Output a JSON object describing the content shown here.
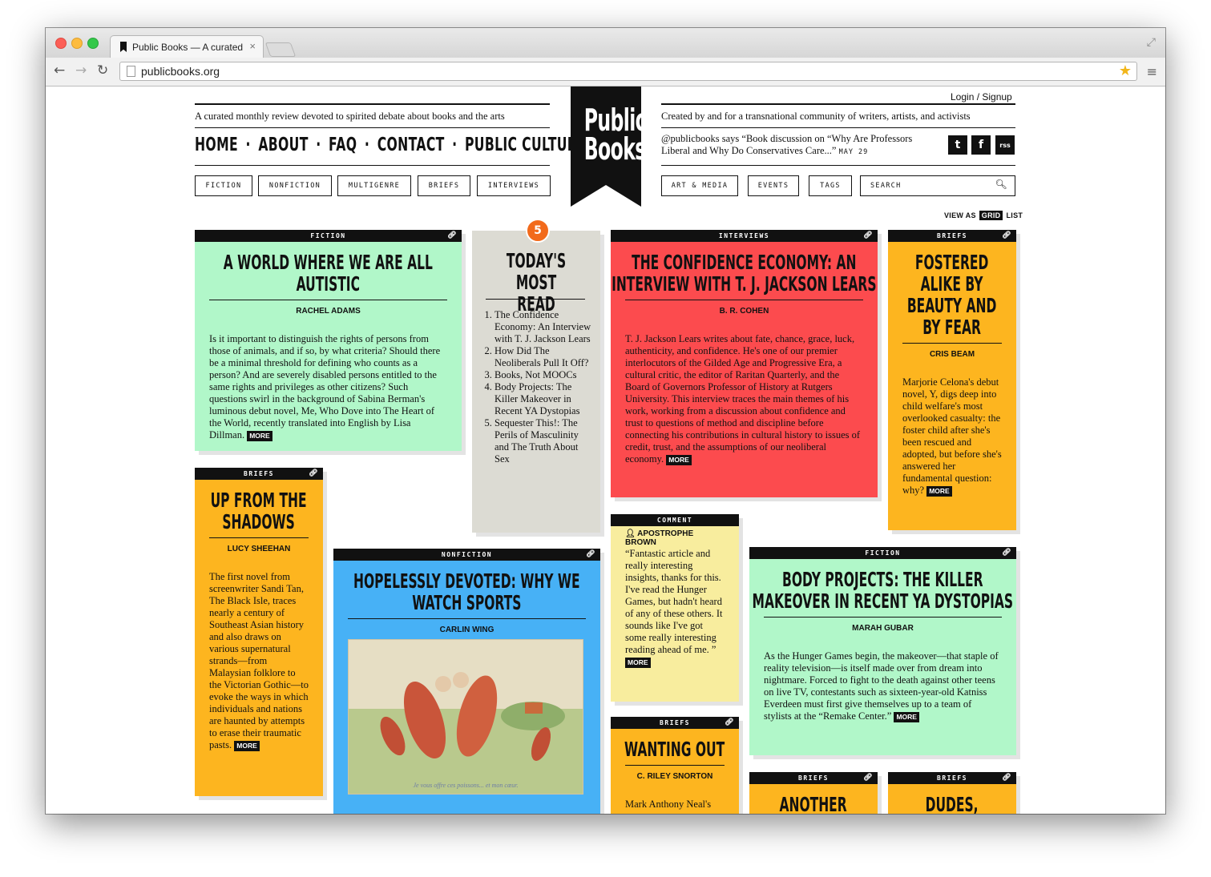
{
  "browser": {
    "tab_title": "Public Books — A curated",
    "tab_close": "×",
    "url": "publicbooks.org",
    "back": "←",
    "forward": "→",
    "reload": "↻",
    "star": "★",
    "menu": "≡",
    "expand": "⤢"
  },
  "header": {
    "login": "Login / Signup",
    "tagline_left": "A curated monthly review devoted to spirited debate about books and the arts",
    "tagline_right": "Created by and for a transnational community of writers, artists, and activists",
    "logo_line1": "Public",
    "logo_line2": "Books",
    "nav": [
      "HOME",
      "ABOUT",
      "FAQ",
      "CONTACT",
      "PUBLIC CULTURE"
    ],
    "nav_sep": "·",
    "categories_left": [
      "FICTION",
      "NONFICTION",
      "MULTIGENRE",
      "BRIEFS",
      "INTERVIEWS"
    ],
    "categories_right": [
      "ART & MEDIA",
      "EVENTS",
      "TAGS"
    ],
    "search_placeholder": "SEARCH",
    "tweet_text": "@publicbooks says “Book discussion on “Why Are Professors Liberal and Why Do Conservatives Care...”",
    "tweet_date": "MAY 29",
    "social": [
      "t",
      "f",
      "rss"
    ],
    "view_as": "VIEW AS",
    "view_grid": "GRID",
    "view_list": "LIST"
  },
  "cards": {
    "autistic": {
      "category": "FICTION",
      "title": "A WORLD WHERE WE ARE ALL AUTISTIC",
      "author": "RACHEL ADAMS",
      "text": "Is it important to distinguish the rights of persons from those of animals, and if so, by what criteria? Should there be a minimal threshold for defining who counts as a person? And are severely disabled persons entitled to the same rights and privileges as other citizens? Such questions swirl in the background of Sabina Berman's luminous debut novel, Me, Who Dove into The Heart of the World, recently translated into English by Lisa Dillman.",
      "more": "MORE",
      "color": "#b1f7c9"
    },
    "most_read": {
      "badge": "5",
      "title": "TODAY'S MOST READ",
      "items": [
        "The Confidence Economy: An Interview with T. J. Jackson Lears",
        "How Did The Neoliberals Pull It Off?",
        "Books, Not MOOCs",
        "Body Projects: The Killer Makeover in Recent YA Dystopias",
        "Sequester This!: The Perils of Masculinity and The Truth About Sex"
      ]
    },
    "confidence": {
      "category": "INTERVIEWS",
      "title": "THE CONFIDENCE ECONOMY: AN INTERVIEW WITH T. J. JACKSON LEARS",
      "author": "B. R. COHEN",
      "text": "T. J. Jackson Lears writes about fate, chance, grace, luck, authenticity, and confidence. He's one of our premier interlocutors of the Gilded Age and Progressive Era, a cultural critic, the editor of Raritan Quarterly, and the Board of Governors Professor of History at Rutgers University. This interview traces the main themes of his work, working from a discussion about confidence and trust to questions of method and discipline before connecting his contributions in cultural history to issues of credit, trust, and the assumptions of our neoliberal economy.",
      "more": "MORE",
      "color": "#fc4b4e"
    },
    "fostered": {
      "category": "BRIEFS",
      "title": "FOSTERED ALIKE BY BEAUTY AND BY FEAR",
      "author": "CRIS BEAM",
      "text": "Marjorie Celona's debut novel, Y, digs deep into child welfare's most overlooked casualty: the foster child after she's been rescued and adopted, but before she's answered her fundamental question: why?",
      "more": "MORE",
      "color": "#fdb51f"
    },
    "shadows": {
      "category": "BRIEFS",
      "title": "UP FROM THE SHADOWS",
      "author": "LUCY SHEEHAN",
      "text": "The first novel from screenwriter Sandi Tan, The Black Isle, traces nearly a century of Southeast Asian history and also draws on various supernatural strands—from Malaysian folklore to the Victorian Gothic—to evoke the ways in which individuals and nations are haunted by attempts to erase their traumatic pasts.",
      "more": "MORE",
      "color": "#fdb51f"
    },
    "devoted": {
      "category": "NONFICTION",
      "title": "HOPELESSLY DEVOTED: WHY WE WATCH SPORTS",
      "author": "CARLIN WING",
      "caption": "Je vous offre ces poissons... et mon cœur.",
      "color": "#47b1f6"
    },
    "comment": {
      "category": "COMMENT",
      "who": "APOSTROPHE BROWN",
      "text": "“Fantastic article and really interesting insights, thanks for this. I've read the Hunger Games, but hadn't heard of any of these others. It sounds like I've got some really interesting reading ahead of me. ”",
      "more": "MORE",
      "color": "#f8ed9e"
    },
    "body_projects": {
      "category": "FICTION",
      "title": "BODY PROJECTS: THE KILLER MAKEOVER IN RECENT YA DYSTOPIAS",
      "author": "MARAH GUBAR",
      "text": "As the Hunger Games begin, the makeover—that staple of reality television—is itself made over from dream into nightmare. Forced to fight to the death against other teens on live TV, contestants such as sixteen-year-old Katniss Everdeen must first give themselves up to a team of stylists at the “Remake Center.”",
      "more": "MORE",
      "color": "#b1f7c9"
    },
    "wanting": {
      "category": "BRIEFS",
      "title": "WANTING OUT",
      "author": "C. RILEY SNORTON",
      "text": "Mark Anthony Neal's",
      "color": "#fdb51f"
    },
    "another": {
      "category": "BRIEFS",
      "title": "ANOTHER",
      "color": "#fdb51f"
    },
    "dudes": {
      "category": "BRIEFS",
      "title": "DUDES, BODIES,",
      "color": "#fdb51f"
    }
  }
}
